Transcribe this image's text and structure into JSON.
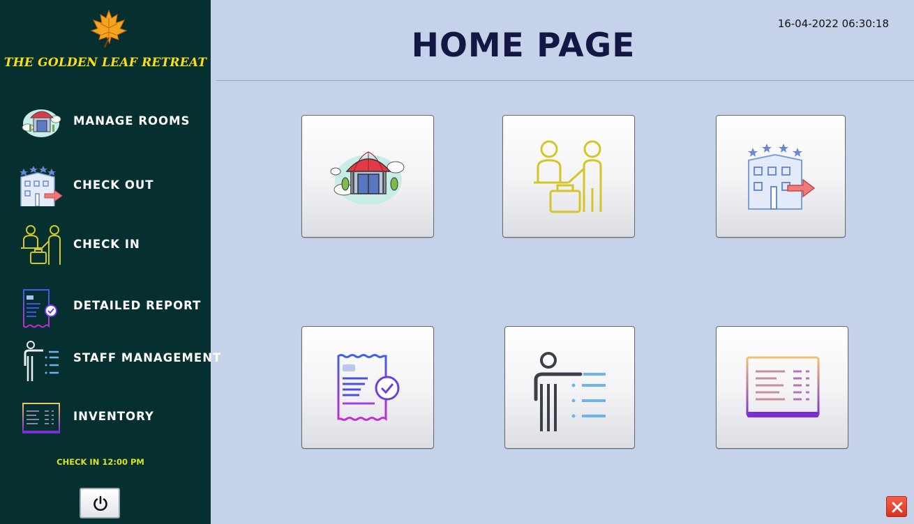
{
  "app": {
    "brand_name": "THE GOLDEN LEAF RETREAT",
    "datetime": "16-04-2022 06:30:18",
    "page_title": "HOME PAGE"
  },
  "sidebar": {
    "items": [
      {
        "label": "MANAGE ROOMS",
        "icon": "hotel-room-icon"
      },
      {
        "label": "CHECK OUT",
        "icon": "hotel-checkout-icon"
      },
      {
        "label": "CHECK IN",
        "icon": "reception-checkin-icon"
      },
      {
        "label": "DETAILED REPORT",
        "icon": "report-receipt-icon"
      },
      {
        "label": "STAFF MANAGEMENT",
        "icon": "staff-list-icon"
      },
      {
        "label": "INVENTORY",
        "icon": "inventory-list-icon"
      }
    ],
    "checkin_time": "CHECK IN 12:00 PM"
  },
  "tiles": [
    {
      "icon": "hotel-room-icon"
    },
    {
      "icon": "reception-checkin-icon"
    },
    {
      "icon": "hotel-checkout-icon"
    },
    {
      "icon": "report-receipt-icon"
    },
    {
      "icon": "staff-list-icon"
    },
    {
      "icon": "inventory-list-icon"
    }
  ],
  "colors": {
    "sidebar_bg": "#06302f",
    "main_bg": "#c5d2ea",
    "brand_gold": "#ffde10",
    "title_navy": "#141743",
    "checkin_yellow": "#d7e128",
    "close_red": "#e2412b"
  }
}
